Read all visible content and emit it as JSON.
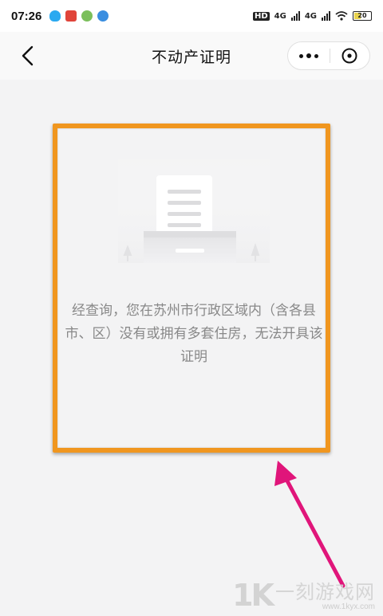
{
  "status_bar": {
    "time": "07:26",
    "network_1": "4G",
    "network_2": "4G",
    "hd": "HD",
    "battery": "20"
  },
  "nav": {
    "title": "不动产证明"
  },
  "main": {
    "message": "经查询，您在苏州市行政区域内（含各县市、区）没有或拥有多套住房，无法开具该证明"
  },
  "watermark": {
    "logo": "1K",
    "text": "一刻游戏网",
    "url": "www.1kyx.com"
  },
  "colors": {
    "highlight": "#f0961f",
    "arrow": "#e0157a"
  }
}
